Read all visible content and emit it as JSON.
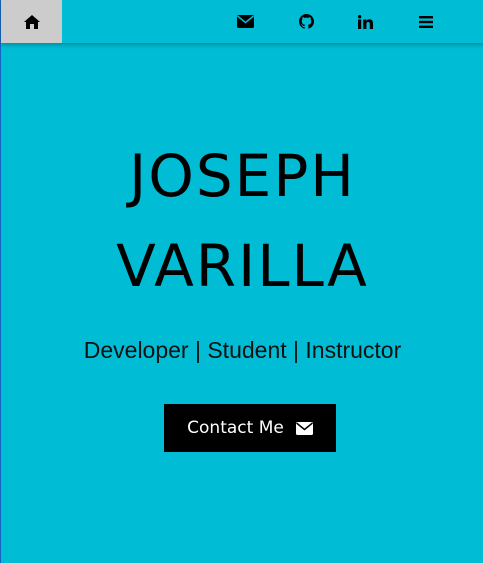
{
  "navbar": {
    "items": [
      {
        "icon": "home-icon",
        "active": true
      },
      {
        "icon": "envelope-icon"
      },
      {
        "icon": "github-icon"
      },
      {
        "icon": "linkedin-icon"
      },
      {
        "icon": "menu-icon"
      }
    ]
  },
  "hero": {
    "name_line_1": "JOSEPH",
    "name_line_2": "VARILLA",
    "tagline": "Developer | Student | Instructor",
    "contact_button_label": "Contact Me",
    "contact_button_icon": "envelope-icon"
  },
  "colors": {
    "background": "#00bcd4",
    "nav_active_background": "#cccccc",
    "button_background": "#000000",
    "button_text": "#ffffff",
    "text": "#000000"
  }
}
